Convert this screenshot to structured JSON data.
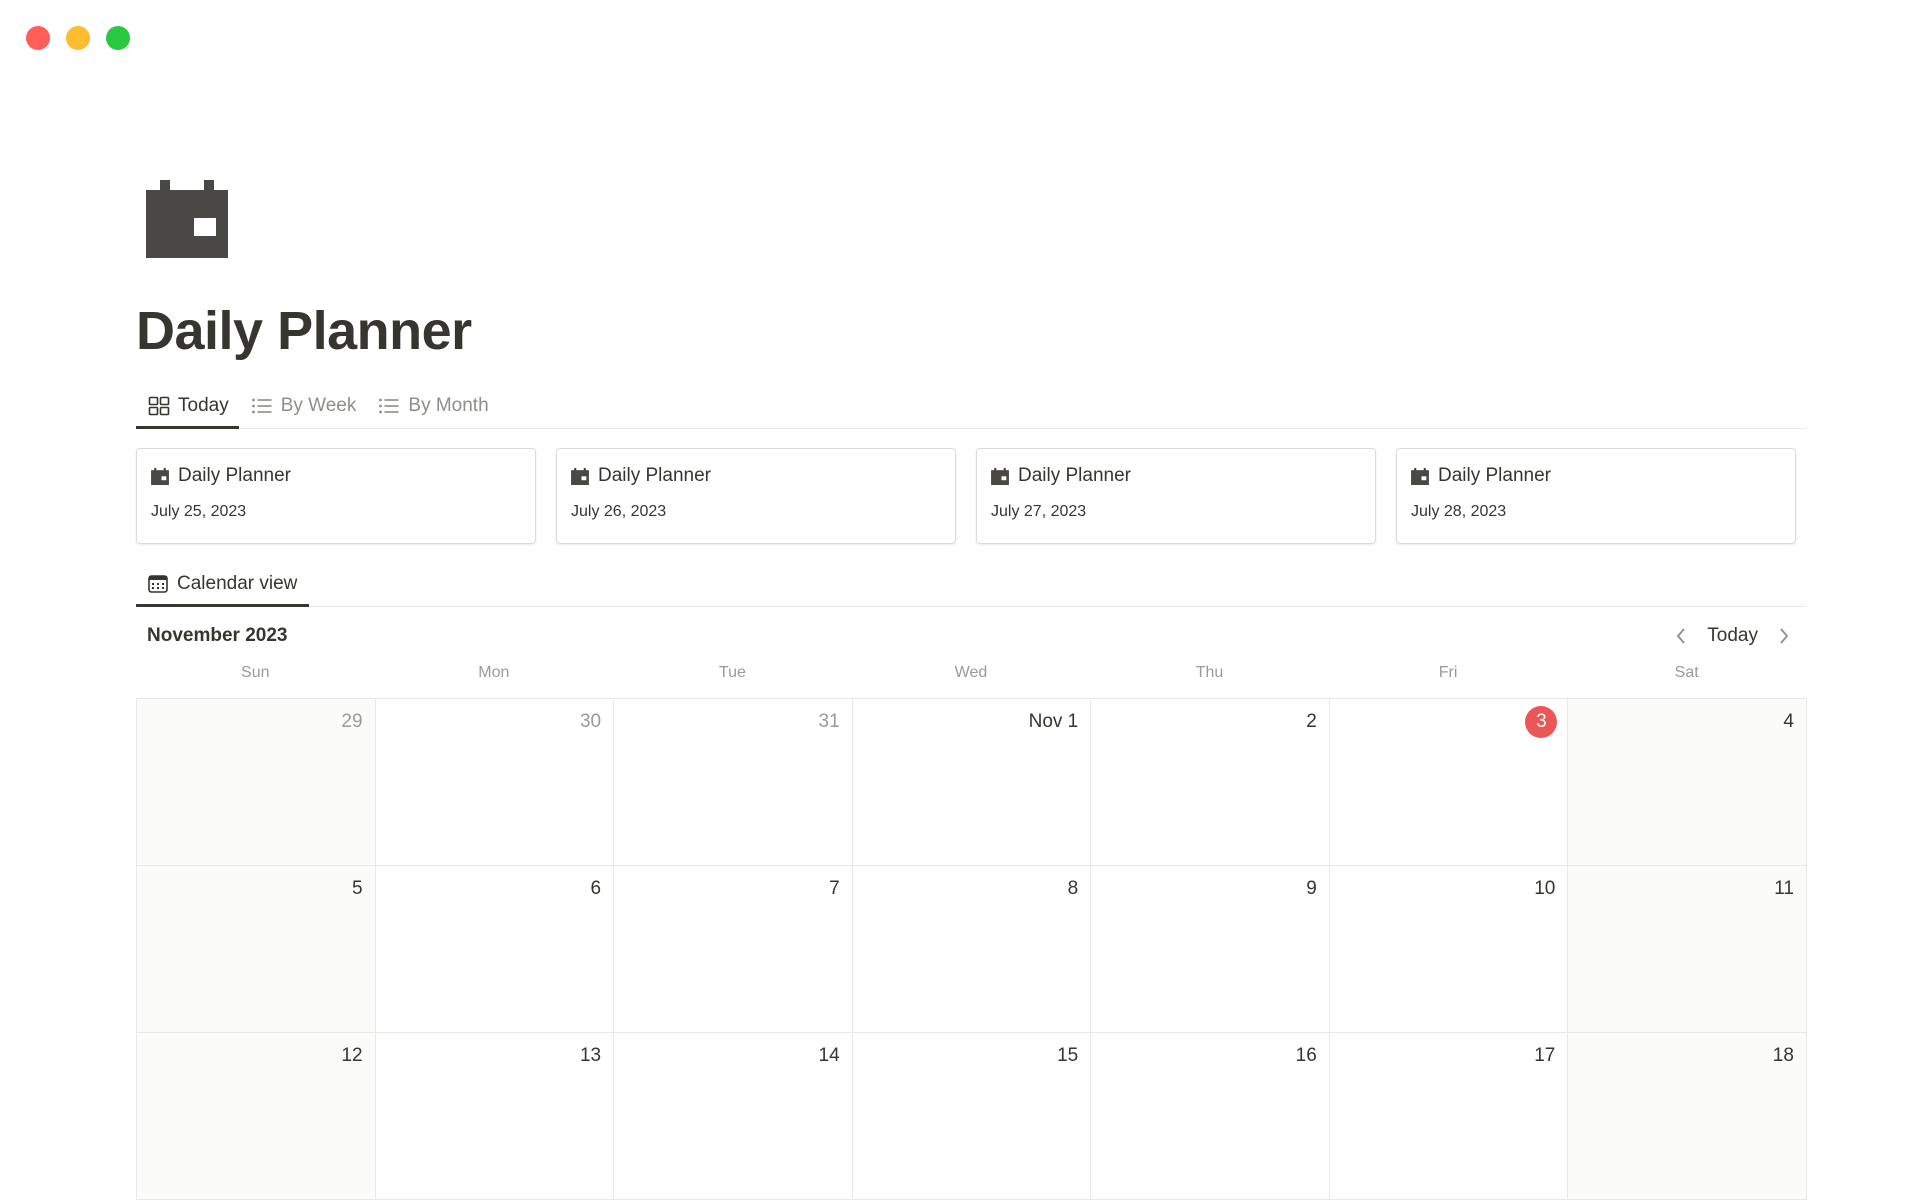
{
  "window": {
    "controls": [
      "close",
      "minimize",
      "maximize"
    ],
    "control_colors": [
      "#ff5f57",
      "#febc2e",
      "#28c840"
    ]
  },
  "page": {
    "icon": "calendar-icon",
    "title": "Daily Planner"
  },
  "view_tabs": [
    {
      "label": "Today",
      "icon": "gallery-icon",
      "active": true
    },
    {
      "label": "By Week",
      "icon": "list-icon",
      "active": false
    },
    {
      "label": "By Month",
      "icon": "list-icon",
      "active": false
    }
  ],
  "cards": [
    {
      "title": "Daily Planner",
      "date": "July 25, 2023",
      "icon": "calendar-icon"
    },
    {
      "title": "Daily Planner",
      "date": "July 26, 2023",
      "icon": "calendar-icon"
    },
    {
      "title": "Daily Planner",
      "date": "July 27, 2023",
      "icon": "calendar-icon"
    },
    {
      "title": "Daily Planner",
      "date": "July 28, 2023",
      "icon": "calendar-icon"
    }
  ],
  "calendar_tab": {
    "label": "Calendar view",
    "icon": "calendar-grid-icon"
  },
  "calendar": {
    "month_label": "November 2023",
    "today_label": "Today",
    "weekdays": [
      "Sun",
      "Mon",
      "Tue",
      "Wed",
      "Thu",
      "Fri",
      "Sat"
    ],
    "weeks": [
      [
        {
          "label": "29",
          "other_month": true
        },
        {
          "label": "30",
          "other_month": true
        },
        {
          "label": "31",
          "other_month": true
        },
        {
          "label": "Nov 1",
          "other_month": false
        },
        {
          "label": "2",
          "other_month": false
        },
        {
          "label": "3",
          "other_month": false,
          "today": true
        },
        {
          "label": "4",
          "other_month": false
        }
      ],
      [
        {
          "label": "5"
        },
        {
          "label": "6"
        },
        {
          "label": "7"
        },
        {
          "label": "8"
        },
        {
          "label": "9"
        },
        {
          "label": "10"
        },
        {
          "label": "11"
        }
      ],
      [
        {
          "label": "12"
        },
        {
          "label": "13"
        },
        {
          "label": "14"
        },
        {
          "label": "15"
        },
        {
          "label": "16"
        },
        {
          "label": "17"
        },
        {
          "label": "18"
        }
      ]
    ],
    "today_color": "#eb5757"
  }
}
